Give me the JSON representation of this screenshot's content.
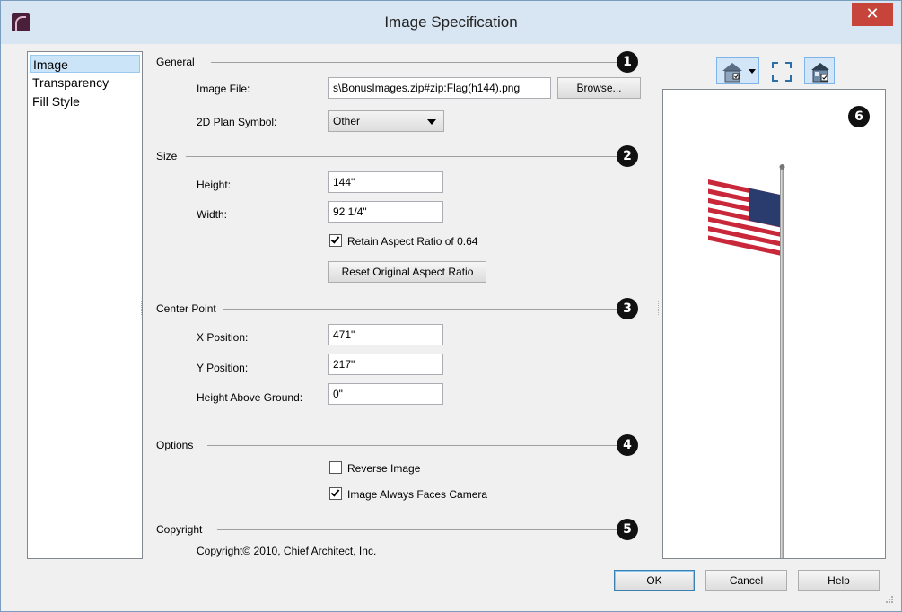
{
  "window": {
    "title": "Image Specification",
    "close_glyph": "✕",
    "app_icon": "chief-architect-icon"
  },
  "nav": {
    "items": [
      {
        "label": "Image",
        "selected": true
      },
      {
        "label": "Transparency",
        "selected": false
      },
      {
        "label": "Fill Style",
        "selected": false
      }
    ]
  },
  "sections": {
    "general": {
      "label": "General",
      "badge": "1"
    },
    "size": {
      "label": "Size",
      "badge": "2"
    },
    "center_point": {
      "label": "Center Point",
      "badge": "3"
    },
    "options": {
      "label": "Options",
      "badge": "4"
    },
    "copyright": {
      "label": "Copyright",
      "badge": "5"
    },
    "preview": {
      "badge": "6"
    }
  },
  "general": {
    "image_file_label": "Image File:",
    "image_file_value": "s\\BonusImages.zip#zip:Flag(h144).png",
    "browse_label": "Browse...",
    "plan_symbol_label": "2D Plan Symbol:",
    "plan_symbol_value": "Other"
  },
  "size": {
    "height_label": "Height:",
    "height_value": "144\"",
    "width_label": "Width:",
    "width_value": "92 1/4\"",
    "retain_label": "Retain Aspect Ratio of 0.64",
    "retain_checked": true,
    "reset_label": "Reset Original Aspect Ratio"
  },
  "center_point": {
    "x_label": "X Position:",
    "x_value": "471\"",
    "y_label": "Y Position:",
    "y_value": "217\"",
    "hag_label": "Height Above Ground:",
    "hag_value": "0\""
  },
  "options": {
    "reverse_label": "Reverse Image",
    "reverse_checked": false,
    "faces_camera_label": "Image Always Faces Camera",
    "faces_camera_checked": true
  },
  "copyright": {
    "text": "Copyright© 2010, Chief Architect, Inc."
  },
  "preview_tools": [
    {
      "icon": "house-view-dropdown-icon"
    },
    {
      "icon": "fit-view-icon"
    },
    {
      "icon": "show-room-icon"
    }
  ],
  "buttons": {
    "ok": "OK",
    "cancel": "Cancel",
    "help": "Help"
  },
  "colors": {
    "titlebar": "#d8e5f2",
    "close": "#c7443a",
    "selection": "#cce4f7"
  }
}
